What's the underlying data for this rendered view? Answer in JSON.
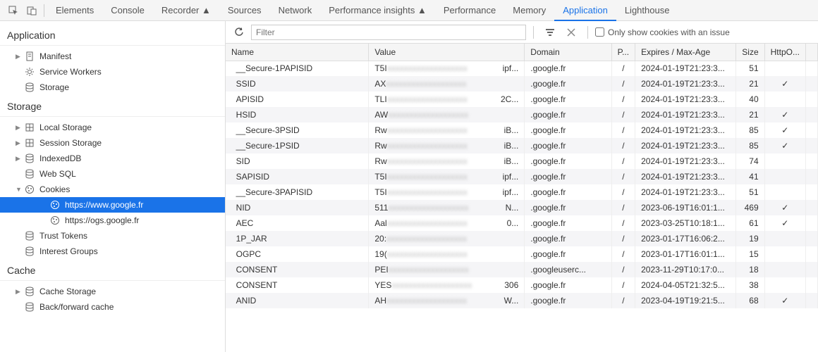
{
  "tabs": [
    "Elements",
    "Console",
    "Recorder ▲",
    "Sources",
    "Network",
    "Performance insights ▲",
    "Performance",
    "Memory",
    "Application",
    "Lighthouse"
  ],
  "active_tab_index": 8,
  "sidebar": {
    "sections": [
      {
        "title": "Application",
        "items": [
          {
            "label": "Manifest",
            "icon": "doc",
            "expandable": true
          },
          {
            "label": "Service Workers",
            "icon": "gear"
          },
          {
            "label": "Storage",
            "icon": "db"
          }
        ]
      },
      {
        "title": "Storage",
        "items": [
          {
            "label": "Local Storage",
            "icon": "grid",
            "expandable": true
          },
          {
            "label": "Session Storage",
            "icon": "grid",
            "expandable": true
          },
          {
            "label": "IndexedDB",
            "icon": "db",
            "expandable": true
          },
          {
            "label": "Web SQL",
            "icon": "db"
          },
          {
            "label": "Cookies",
            "icon": "cookie",
            "expandable": true,
            "expanded": true,
            "children": [
              {
                "label": "https://www.google.fr",
                "icon": "cookie",
                "selected": true
              },
              {
                "label": "https://ogs.google.fr",
                "icon": "cookie"
              }
            ]
          },
          {
            "label": "Trust Tokens",
            "icon": "db"
          },
          {
            "label": "Interest Groups",
            "icon": "db"
          }
        ]
      },
      {
        "title": "Cache",
        "items": [
          {
            "label": "Cache Storage",
            "icon": "db",
            "expandable": true
          },
          {
            "label": "Back/forward cache",
            "icon": "db"
          }
        ]
      }
    ]
  },
  "filter_placeholder": "Filter",
  "only_issue_label": "Only show cookies with an issue",
  "columns": [
    "Name",
    "Value",
    "Domain",
    "P...",
    "Expires / Max-Age",
    "Size",
    "HttpO..."
  ],
  "cookies": [
    {
      "name": "__Secure-1PAPISID",
      "vpre": "T5I",
      "vsuf": "ipf...",
      "domain": ".google.fr",
      "path": "/",
      "exp": "2024-01-19T21:23:3...",
      "size": "51",
      "http": ""
    },
    {
      "name": "SSID",
      "vpre": "AX",
      "vsuf": "",
      "domain": ".google.fr",
      "path": "/",
      "exp": "2024-01-19T21:23:3...",
      "size": "21",
      "http": "✓"
    },
    {
      "name": "APISID",
      "vpre": "TLI",
      "vsuf": "2C...",
      "domain": ".google.fr",
      "path": "/",
      "exp": "2024-01-19T21:23:3...",
      "size": "40",
      "http": ""
    },
    {
      "name": "HSID",
      "vpre": "AW",
      "vsuf": "",
      "domain": ".google.fr",
      "path": "/",
      "exp": "2024-01-19T21:23:3...",
      "size": "21",
      "http": "✓"
    },
    {
      "name": "__Secure-3PSID",
      "vpre": "Rw",
      "vsuf": "iB...",
      "domain": ".google.fr",
      "path": "/",
      "exp": "2024-01-19T21:23:3...",
      "size": "85",
      "http": "✓"
    },
    {
      "name": "__Secure-1PSID",
      "vpre": "Rw",
      "vsuf": "iB...",
      "domain": ".google.fr",
      "path": "/",
      "exp": "2024-01-19T21:23:3...",
      "size": "85",
      "http": "✓"
    },
    {
      "name": "SID",
      "vpre": "Rw",
      "vsuf": "iB...",
      "domain": ".google.fr",
      "path": "/",
      "exp": "2024-01-19T21:23:3...",
      "size": "74",
      "http": ""
    },
    {
      "name": "SAPISID",
      "vpre": "T5I",
      "vsuf": "ipf...",
      "domain": ".google.fr",
      "path": "/",
      "exp": "2024-01-19T21:23:3...",
      "size": "41",
      "http": ""
    },
    {
      "name": "__Secure-3PAPISID",
      "vpre": "T5I",
      "vsuf": "ipf...",
      "domain": ".google.fr",
      "path": "/",
      "exp": "2024-01-19T21:23:3...",
      "size": "51",
      "http": ""
    },
    {
      "name": "NID",
      "vpre": "511",
      "vsuf": "N...",
      "domain": ".google.fr",
      "path": "/",
      "exp": "2023-06-19T16:01:1...",
      "size": "469",
      "http": "✓"
    },
    {
      "name": "AEC",
      "vpre": "Aal",
      "vsuf": "0...",
      "domain": ".google.fr",
      "path": "/",
      "exp": "2023-03-25T10:18:1...",
      "size": "61",
      "http": "✓"
    },
    {
      "name": "1P_JAR",
      "vpre": "20:",
      "vsuf": "",
      "domain": ".google.fr",
      "path": "/",
      "exp": "2023-01-17T16:06:2...",
      "size": "19",
      "http": ""
    },
    {
      "name": "OGPC",
      "vpre": "19(",
      "vsuf": "",
      "domain": ".google.fr",
      "path": "/",
      "exp": "2023-01-17T16:01:1...",
      "size": "15",
      "http": ""
    },
    {
      "name": "CONSENT",
      "vpre": "PEI",
      "vsuf": "",
      "domain": ".googleuserc...",
      "path": "/",
      "exp": "2023-11-29T10:17:0...",
      "size": "18",
      "http": ""
    },
    {
      "name": "CONSENT",
      "vpre": "YES",
      "vsuf": "306",
      "domain": ".google.fr",
      "path": "/",
      "exp": "2024-04-05T21:32:5...",
      "size": "38",
      "http": ""
    },
    {
      "name": "ANID",
      "vpre": "AH",
      "vsuf": "W...",
      "domain": ".google.fr",
      "path": "/",
      "exp": "2023-04-19T19:21:5...",
      "size": "68",
      "http": "✓"
    }
  ]
}
